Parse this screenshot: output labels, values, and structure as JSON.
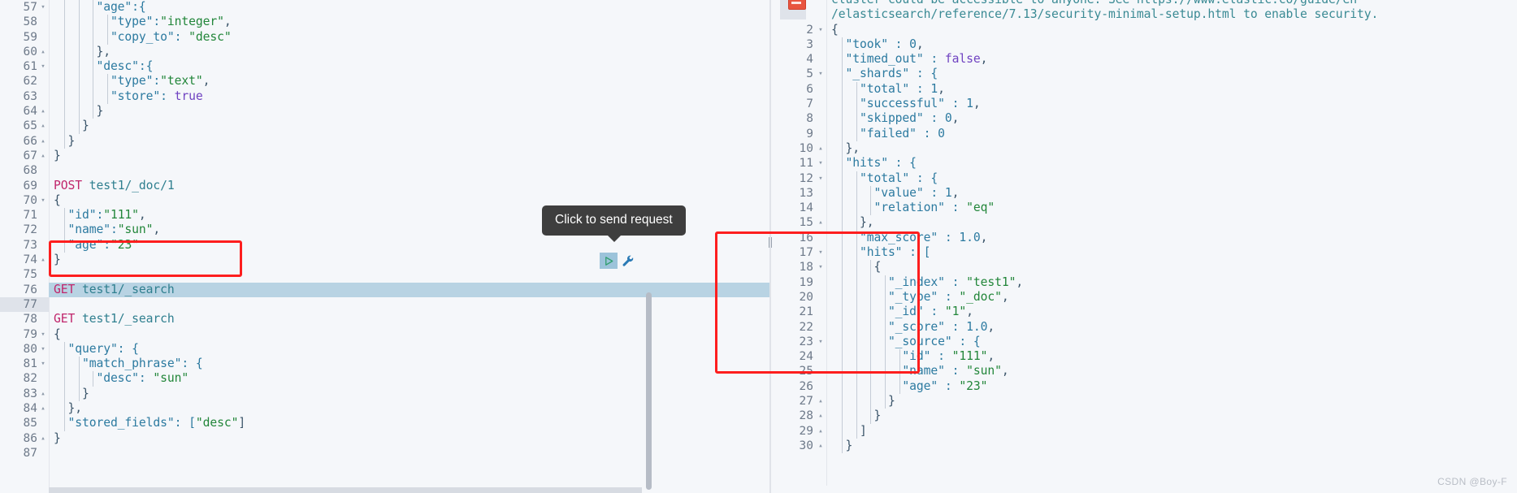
{
  "app": {
    "name": "kibana-dev-tools-console",
    "watermark": "CSDN @Boy-F"
  },
  "tooltip": {
    "text": "Click to send request"
  },
  "line_actions": {
    "play": {
      "name": "send-request-play-icon",
      "title": "Click to send request"
    },
    "wrench": {
      "name": "open-documentation-wrench-icon",
      "title": "Open documentation"
    }
  },
  "colors": {
    "editor_bg": "#f5f7fa",
    "gutter_text": "#6e7a8a",
    "active_line": "#b8d3e3",
    "annotation_red": "#fd1e1e",
    "tooltip_bg": "#3e3e3e",
    "method_pink": "#c0256b",
    "string_green": "#22863a",
    "key_blue": "#2c7aa0",
    "bool_purple": "#6f42c1"
  },
  "request_editor": {
    "name": "request-editor",
    "first_line_number": 57,
    "active_line": 77,
    "lines": [
      {
        "n": 57,
        "fold": "▾",
        "indent": 3,
        "text": "  \"age\":{",
        "tokens": [
          {
            "t": "      \"age\":{",
            "c": "k-key"
          }
        ]
      },
      {
        "n": 58,
        "fold": "",
        "indent": 4,
        "text": "    \"type\":\"integer\",",
        "tokens": [
          {
            "t": "        \"type\":",
            "c": "k-key"
          },
          {
            "t": "\"integer\"",
            "c": "k-str"
          },
          {
            "t": ",",
            "c": "k-punct"
          }
        ]
      },
      {
        "n": 59,
        "fold": "",
        "indent": 4,
        "text": "    \"copy_to\": \"desc\"",
        "tokens": [
          {
            "t": "        \"copy_to\": ",
            "c": "k-key"
          },
          {
            "t": "\"desc\"",
            "c": "k-str"
          }
        ]
      },
      {
        "n": 60,
        "fold": "▴",
        "indent": 3,
        "text": "  },",
        "tokens": [
          {
            "t": "      },",
            "c": "k-punct"
          }
        ]
      },
      {
        "n": 61,
        "fold": "▾",
        "indent": 3,
        "text": "  \"desc\":{",
        "tokens": [
          {
            "t": "      \"desc\":{",
            "c": "k-key"
          }
        ]
      },
      {
        "n": 62,
        "fold": "",
        "indent": 4,
        "text": "    \"type\":\"text\",",
        "tokens": [
          {
            "t": "        \"type\":",
            "c": "k-key"
          },
          {
            "t": "\"text\"",
            "c": "k-str"
          },
          {
            "t": ",",
            "c": "k-punct"
          }
        ]
      },
      {
        "n": 63,
        "fold": "",
        "indent": 4,
        "text": "    \"store\": true",
        "tokens": [
          {
            "t": "        \"store\": ",
            "c": "k-key"
          },
          {
            "t": "true",
            "c": "k-bool"
          }
        ]
      },
      {
        "n": 64,
        "fold": "▴",
        "indent": 3,
        "text": "  }",
        "tokens": [
          {
            "t": "      }",
            "c": "k-punct"
          }
        ]
      },
      {
        "n": 65,
        "fold": "▴",
        "indent": 2,
        "text": " }",
        "tokens": [
          {
            "t": "    }",
            "c": "k-punct"
          }
        ]
      },
      {
        "n": 66,
        "fold": "▴",
        "indent": 1,
        "text": "}",
        "tokens": [
          {
            "t": "  }",
            "c": "k-punct"
          }
        ]
      },
      {
        "n": 67,
        "fold": "▴",
        "indent": 0,
        "text": "}",
        "tokens": [
          {
            "t": "}",
            "c": "k-punct"
          }
        ]
      },
      {
        "n": 68,
        "fold": "",
        "indent": 0,
        "text": "",
        "tokens": []
      },
      {
        "n": 69,
        "fold": "",
        "indent": 0,
        "text": "POST test1/_doc/1",
        "tokens": [
          {
            "t": "POST",
            "c": "k-method"
          },
          {
            "t": " test1/_doc/1",
            "c": "k-url"
          }
        ]
      },
      {
        "n": 70,
        "fold": "▾",
        "indent": 0,
        "text": "{",
        "tokens": [
          {
            "t": "{",
            "c": "k-punct"
          }
        ]
      },
      {
        "n": 71,
        "fold": "",
        "indent": 1,
        "text": "  \"id\":\"111\",",
        "tokens": [
          {
            "t": "  \"id\":",
            "c": "k-key"
          },
          {
            "t": "\"111\"",
            "c": "k-str"
          },
          {
            "t": ",",
            "c": "k-punct"
          }
        ]
      },
      {
        "n": 72,
        "fold": "",
        "indent": 1,
        "text": "  \"name\":\"sun\",",
        "tokens": [
          {
            "t": "  \"name\":",
            "c": "k-key"
          },
          {
            "t": "\"sun\"",
            "c": "k-str"
          },
          {
            "t": ",",
            "c": "k-punct"
          }
        ]
      },
      {
        "n": 73,
        "fold": "",
        "indent": 1,
        "text": "  \"age\":\"23\"",
        "tokens": [
          {
            "t": "  \"age\":",
            "c": "k-key"
          },
          {
            "t": "\"23\"",
            "c": "k-str"
          }
        ]
      },
      {
        "n": 74,
        "fold": "▴",
        "indent": 0,
        "text": "}",
        "tokens": [
          {
            "t": "}",
            "c": "k-punct"
          }
        ]
      },
      {
        "n": 75,
        "fold": "",
        "indent": 0,
        "text": "",
        "tokens": []
      },
      {
        "n": 76,
        "fold": "",
        "indent": 0,
        "text": "GET test1/_search",
        "highlight": true,
        "tokens": [
          {
            "t": "GET",
            "c": "k-method"
          },
          {
            "t": " test1/_search",
            "c": "k-url"
          }
        ]
      },
      {
        "n": 77,
        "fold": "",
        "indent": 0,
        "text": "",
        "tokens": []
      },
      {
        "n": 78,
        "fold": "",
        "indent": 0,
        "text": "GET test1/_search",
        "tokens": [
          {
            "t": "GET",
            "c": "k-method"
          },
          {
            "t": " test1/_search",
            "c": "k-url"
          }
        ]
      },
      {
        "n": 79,
        "fold": "▾",
        "indent": 0,
        "text": "{",
        "tokens": [
          {
            "t": "{",
            "c": "k-punct"
          }
        ]
      },
      {
        "n": 80,
        "fold": "▾",
        "indent": 1,
        "text": "  \"query\": {",
        "tokens": [
          {
            "t": "  \"query\": {",
            "c": "k-key"
          }
        ]
      },
      {
        "n": 81,
        "fold": "▾",
        "indent": 2,
        "text": "    \"match_phrase\": {",
        "tokens": [
          {
            "t": "    \"match_phrase\": {",
            "c": "k-key"
          }
        ]
      },
      {
        "n": 82,
        "fold": "",
        "indent": 3,
        "text": "      \"desc\": \"sun\"",
        "tokens": [
          {
            "t": "      \"desc\": ",
            "c": "k-key"
          },
          {
            "t": "\"sun\"",
            "c": "k-str"
          }
        ]
      },
      {
        "n": 83,
        "fold": "▴",
        "indent": 2,
        "text": "    }",
        "tokens": [
          {
            "t": "    }",
            "c": "k-punct"
          }
        ]
      },
      {
        "n": 84,
        "fold": "▴",
        "indent": 1,
        "text": "  },",
        "tokens": [
          {
            "t": "  },",
            "c": "k-punct"
          }
        ]
      },
      {
        "n": 85,
        "fold": "",
        "indent": 1,
        "text": "  \"stored_fields\": [\"desc\"]",
        "tokens": [
          {
            "t": "  \"stored_fields\": [",
            "c": "k-key"
          },
          {
            "t": "\"desc\"",
            "c": "k-str"
          },
          {
            "t": "]",
            "c": "k-punct"
          }
        ]
      },
      {
        "n": 86,
        "fold": "▴",
        "indent": 0,
        "text": "}",
        "tokens": [
          {
            "t": "}",
            "c": "k-punct"
          }
        ]
      },
      {
        "n": 87,
        "fold": "",
        "indent": 0,
        "text": "",
        "tokens": []
      }
    ]
  },
  "response_editor": {
    "name": "response-editor",
    "warning_text_line1": "cluster could be accessible to anyone. See https://www.elastic.co/guide/en",
    "warning_text_line2": "/elasticsearch/reference/7.13/security-minimal-setup.html to enable security.",
    "lines": [
      {
        "n": "",
        "fold": "",
        "indent": 0,
        "text": "cluster could be accessible to anyone. See https://www.elastic.co/guide/en",
        "clipped": true,
        "tokens": [
          {
            "t": "cluster could be accessible to anyone. See https://www.elastic.co/guide/en",
            "c": "k-warn"
          }
        ]
      },
      {
        "n": "",
        "fold": "",
        "indent": 0,
        "text": "/elasticsearch/reference/7.13/security-minimal-setup.html to enable security.",
        "tokens": [
          {
            "t": "/elasticsearch/reference/7.13/security-minimal-setup.html to enable security.",
            "c": "k-warn"
          }
        ]
      },
      {
        "n": 2,
        "fold": "▾",
        "indent": 0,
        "text": "{",
        "tokens": [
          {
            "t": "{",
            "c": "k-punct"
          }
        ]
      },
      {
        "n": 3,
        "fold": "",
        "indent": 1,
        "text": "  \"took\" : 0,",
        "tokens": [
          {
            "t": "  \"took\" : ",
            "c": "k-key"
          },
          {
            "t": "0",
            "c": "k-num"
          },
          {
            "t": ",",
            "c": "k-punct"
          }
        ]
      },
      {
        "n": 4,
        "fold": "",
        "indent": 1,
        "text": "  \"timed_out\" : false,",
        "tokens": [
          {
            "t": "  \"timed_out\" : ",
            "c": "k-key"
          },
          {
            "t": "false",
            "c": "k-bool"
          },
          {
            "t": ",",
            "c": "k-punct"
          }
        ]
      },
      {
        "n": 5,
        "fold": "▾",
        "indent": 1,
        "text": "  \"_shards\" : {",
        "tokens": [
          {
            "t": "  \"_shards\" : {",
            "c": "k-key"
          }
        ]
      },
      {
        "n": 6,
        "fold": "",
        "indent": 2,
        "text": "    \"total\" : 1,",
        "tokens": [
          {
            "t": "    \"total\" : ",
            "c": "k-key"
          },
          {
            "t": "1",
            "c": "k-num"
          },
          {
            "t": ",",
            "c": "k-punct"
          }
        ]
      },
      {
        "n": 7,
        "fold": "",
        "indent": 2,
        "text": "    \"successful\" : 1,",
        "tokens": [
          {
            "t": "    \"successful\" : ",
            "c": "k-key"
          },
          {
            "t": "1",
            "c": "k-num"
          },
          {
            "t": ",",
            "c": "k-punct"
          }
        ]
      },
      {
        "n": 8,
        "fold": "",
        "indent": 2,
        "text": "    \"skipped\" : 0,",
        "tokens": [
          {
            "t": "    \"skipped\" : ",
            "c": "k-key"
          },
          {
            "t": "0",
            "c": "k-num"
          },
          {
            "t": ",",
            "c": "k-punct"
          }
        ]
      },
      {
        "n": 9,
        "fold": "",
        "indent": 2,
        "text": "    \"failed\" : 0",
        "tokens": [
          {
            "t": "    \"failed\" : ",
            "c": "k-key"
          },
          {
            "t": "0",
            "c": "k-num"
          }
        ]
      },
      {
        "n": 10,
        "fold": "▴",
        "indent": 1,
        "text": "  },",
        "tokens": [
          {
            "t": "  },",
            "c": "k-punct"
          }
        ]
      },
      {
        "n": 11,
        "fold": "▾",
        "indent": 1,
        "text": "  \"hits\" : {",
        "tokens": [
          {
            "t": "  \"hits\" : {",
            "c": "k-key"
          }
        ]
      },
      {
        "n": 12,
        "fold": "▾",
        "indent": 2,
        "text": "    \"total\" : {",
        "tokens": [
          {
            "t": "    \"total\" : {",
            "c": "k-key"
          }
        ]
      },
      {
        "n": 13,
        "fold": "",
        "indent": 3,
        "text": "      \"value\" : 1,",
        "tokens": [
          {
            "t": "      \"value\" : ",
            "c": "k-key"
          },
          {
            "t": "1",
            "c": "k-num"
          },
          {
            "t": ",",
            "c": "k-punct"
          }
        ]
      },
      {
        "n": 14,
        "fold": "",
        "indent": 3,
        "text": "      \"relation\" : \"eq\"",
        "tokens": [
          {
            "t": "      \"relation\" : ",
            "c": "k-key"
          },
          {
            "t": "\"eq\"",
            "c": "k-str"
          }
        ]
      },
      {
        "n": 15,
        "fold": "▴",
        "indent": 2,
        "text": "    },",
        "tokens": [
          {
            "t": "    },",
            "c": "k-punct"
          }
        ]
      },
      {
        "n": 16,
        "fold": "",
        "indent": 2,
        "text": "    \"max_score\" : 1.0,",
        "tokens": [
          {
            "t": "    \"max_score\" : ",
            "c": "k-key"
          },
          {
            "t": "1.0",
            "c": "k-num"
          },
          {
            "t": ",",
            "c": "k-punct"
          }
        ]
      },
      {
        "n": 17,
        "fold": "▾",
        "indent": 2,
        "text": "    \"hits\" : [",
        "tokens": [
          {
            "t": "    \"hits\" : [",
            "c": "k-key"
          }
        ]
      },
      {
        "n": 18,
        "fold": "▾",
        "indent": 3,
        "text": "      {",
        "tokens": [
          {
            "t": "      {",
            "c": "k-punct"
          }
        ]
      },
      {
        "n": 19,
        "fold": "",
        "indent": 4,
        "text": "        \"_index\" : \"test1\",",
        "tokens": [
          {
            "t": "        \"_index\" : ",
            "c": "k-key"
          },
          {
            "t": "\"test1\"",
            "c": "k-str"
          },
          {
            "t": ",",
            "c": "k-punct"
          }
        ]
      },
      {
        "n": 20,
        "fold": "",
        "indent": 4,
        "text": "        \"_type\" : \"_doc\",",
        "tokens": [
          {
            "t": "        \"_type\" : ",
            "c": "k-key"
          },
          {
            "t": "\"_doc\"",
            "c": "k-str"
          },
          {
            "t": ",",
            "c": "k-punct"
          }
        ]
      },
      {
        "n": 21,
        "fold": "",
        "indent": 4,
        "text": "        \"_id\" : \"1\",",
        "tokens": [
          {
            "t": "        \"_id\" : ",
            "c": "k-key"
          },
          {
            "t": "\"1\"",
            "c": "k-str"
          },
          {
            "t": ",",
            "c": "k-punct"
          }
        ]
      },
      {
        "n": 22,
        "fold": "",
        "indent": 4,
        "text": "        \"_score\" : 1.0,",
        "tokens": [
          {
            "t": "        \"_score\" : ",
            "c": "k-key"
          },
          {
            "t": "1.0",
            "c": "k-num"
          },
          {
            "t": ",",
            "c": "k-punct"
          }
        ]
      },
      {
        "n": 23,
        "fold": "▾",
        "indent": 4,
        "text": "        \"_source\" : {",
        "tokens": [
          {
            "t": "        \"_source\" : {",
            "c": "k-key"
          }
        ]
      },
      {
        "n": 24,
        "fold": "",
        "indent": 5,
        "text": "          \"id\" : \"111\",",
        "tokens": [
          {
            "t": "          \"id\" : ",
            "c": "k-key"
          },
          {
            "t": "\"111\"",
            "c": "k-str"
          },
          {
            "t": ",",
            "c": "k-punct"
          }
        ]
      },
      {
        "n": 25,
        "fold": "",
        "indent": 5,
        "text": "          \"name\" : \"sun\",",
        "tokens": [
          {
            "t": "          \"name\" : ",
            "c": "k-key"
          },
          {
            "t": "\"sun\"",
            "c": "k-str"
          },
          {
            "t": ",",
            "c": "k-punct"
          }
        ]
      },
      {
        "n": 26,
        "fold": "",
        "indent": 5,
        "text": "          \"age\" : \"23\"",
        "tokens": [
          {
            "t": "          \"age\" : ",
            "c": "k-key"
          },
          {
            "t": "\"23\"",
            "c": "k-str"
          }
        ]
      },
      {
        "n": 27,
        "fold": "▴",
        "indent": 4,
        "text": "        }",
        "tokens": [
          {
            "t": "        }",
            "c": "k-punct"
          }
        ]
      },
      {
        "n": 28,
        "fold": "▴",
        "indent": 3,
        "text": "      }",
        "tokens": [
          {
            "t": "      }",
            "c": "k-punct"
          }
        ]
      },
      {
        "n": 29,
        "fold": "▴",
        "indent": 2,
        "text": "    ]",
        "tokens": [
          {
            "t": "    ]",
            "c": "k-punct"
          }
        ]
      },
      {
        "n": 30,
        "fold": "▴",
        "indent": 1,
        "text": "  }",
        "tokens": [
          {
            "t": "  }",
            "c": "k-punct"
          }
        ]
      }
    ]
  },
  "annotations": [
    {
      "name": "annotation-box-request",
      "target": "GET test1/_search (line 76)"
    },
    {
      "name": "annotation-box-response-hits",
      "target": "hits array (lines 17-27)"
    }
  ]
}
